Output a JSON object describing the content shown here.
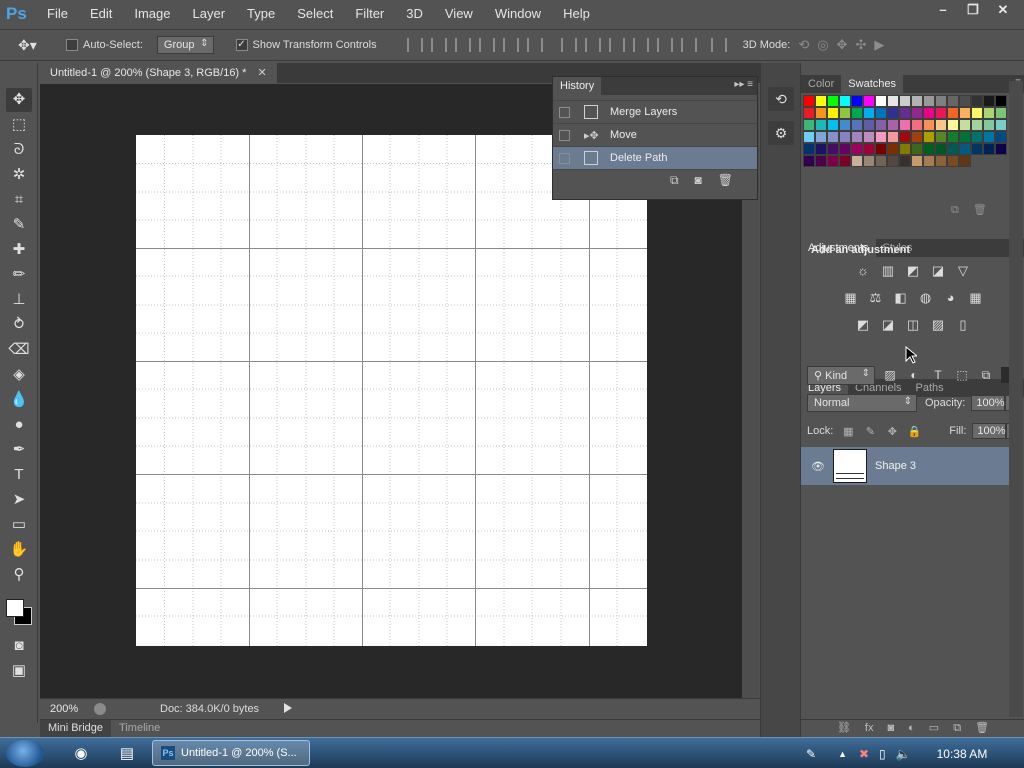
{
  "app": {
    "logo_text": "Ps",
    "menus": [
      "File",
      "Edit",
      "Image",
      "Layer",
      "Type",
      "Select",
      "Filter",
      "3D",
      "View",
      "Window",
      "Help"
    ]
  },
  "options_bar": {
    "auto_select_label": "Auto-Select:",
    "auto_select_checked": false,
    "group_value": "Group",
    "show_transform_label": "Show Transform Controls",
    "show_transform_checked": true,
    "mode_3d_label": "3D Mode:"
  },
  "document": {
    "tab_title": "Untitled-1 @ 200% (Shape 3, RGB/16) *",
    "zoom": "200%",
    "doc_info": "Doc: 384.0K/0 bytes"
  },
  "bottom_tabs": {
    "mini_bridge": "Mini Bridge",
    "timeline": "Timeline"
  },
  "history": {
    "tab_label": "History",
    "items": [
      {
        "label": "Merge Layers",
        "selected": false
      },
      {
        "label": "Move",
        "selected": false
      },
      {
        "label": "Delete Path",
        "selected": true
      }
    ]
  },
  "swatches_panel": {
    "tabs": [
      "Color",
      "Swatches"
    ],
    "active_tab": "Swatches",
    "colors": [
      "#ff0000",
      "#ffff00",
      "#00ff00",
      "#00ffff",
      "#0000ff",
      "#ff00ff",
      "#ffffff",
      "#e6e6e6",
      "#cccccc",
      "#b3b3b3",
      "#999999",
      "#808080",
      "#666666",
      "#4d4d4d",
      "#333333",
      "#1a1a1a",
      "#000000",
      "#ed1c24",
      "#f7941d",
      "#fff200",
      "#8dc63f",
      "#00a651",
      "#00aeef",
      "#0072bc",
      "#2e3192",
      "#662d91",
      "#92278f",
      "#ec008c",
      "#ed145b",
      "#f26522",
      "#fbaf5d",
      "#fff568",
      "#acd373",
      "#7cc576",
      "#3bb878",
      "#1abbb4",
      "#00bff3",
      "#438ccb",
      "#5574b9",
      "#605ca8",
      "#855fa8",
      "#a763a8",
      "#f06eaa",
      "#f26d7d",
      "#f68e56",
      "#fdc689",
      "#fff799",
      "#c4df9b",
      "#a3d39c",
      "#82ca9c",
      "#7accc8",
      "#6dcff6",
      "#7da7d9",
      "#8393ca",
      "#8781bd",
      "#a186be",
      "#bd8cbf",
      "#f49ac2",
      "#f5989d",
      "#9e0b0f",
      "#a0410d",
      "#aba000",
      "#598527",
      "#197b30",
      "#007236",
      "#00746b",
      "#0076a3",
      "#004a80",
      "#003471",
      "#1b1464",
      "#440e62",
      "#630460",
      "#9e005d",
      "#9e0039",
      "#790000",
      "#7b2e00",
      "#827b00",
      "#406618",
      "#005e20",
      "#005826",
      "#005952",
      "#005b7f",
      "#003663",
      "#002157",
      "#0d004c",
      "#32004b",
      "#4b0049",
      "#7b0046",
      "#7a0026",
      "#c7b299",
      "#998675",
      "#736357",
      "#534741",
      "#37302d",
      "#c69c6d",
      "#a67c52",
      "#8c6239",
      "#754c24",
      "#603913"
    ]
  },
  "adjustments": {
    "tabs": [
      "Adjustments",
      "Styles"
    ],
    "title": "Add an adjustment",
    "row1": [
      "☼",
      "▥",
      "◩",
      "◪",
      "▽"
    ],
    "row2": [
      "▦",
      "⚖",
      "◧",
      "◍",
      "◕",
      "▦"
    ],
    "row3": [
      "◩",
      "◪",
      "◫",
      "▨",
      "▯"
    ]
  },
  "layers": {
    "tabs": [
      "Layers",
      "Channels",
      "Paths"
    ],
    "kind_value": "Kind",
    "blend_mode": "Normal",
    "opacity_label": "Opacity:",
    "opacity_value": "100%",
    "lock_label": "Lock:",
    "fill_label": "Fill:",
    "fill_value": "100%",
    "layer_items": [
      {
        "name": "Shape 3",
        "visible": true,
        "selected": true
      }
    ]
  },
  "taskbar": {
    "ps_task_label": "Untitled-1 @ 200% (S...",
    "clock": "10:38 AM"
  },
  "colors": {
    "canvas_bg": "#282828",
    "selection": "#6b7c92",
    "panel_bg": "#535353"
  }
}
